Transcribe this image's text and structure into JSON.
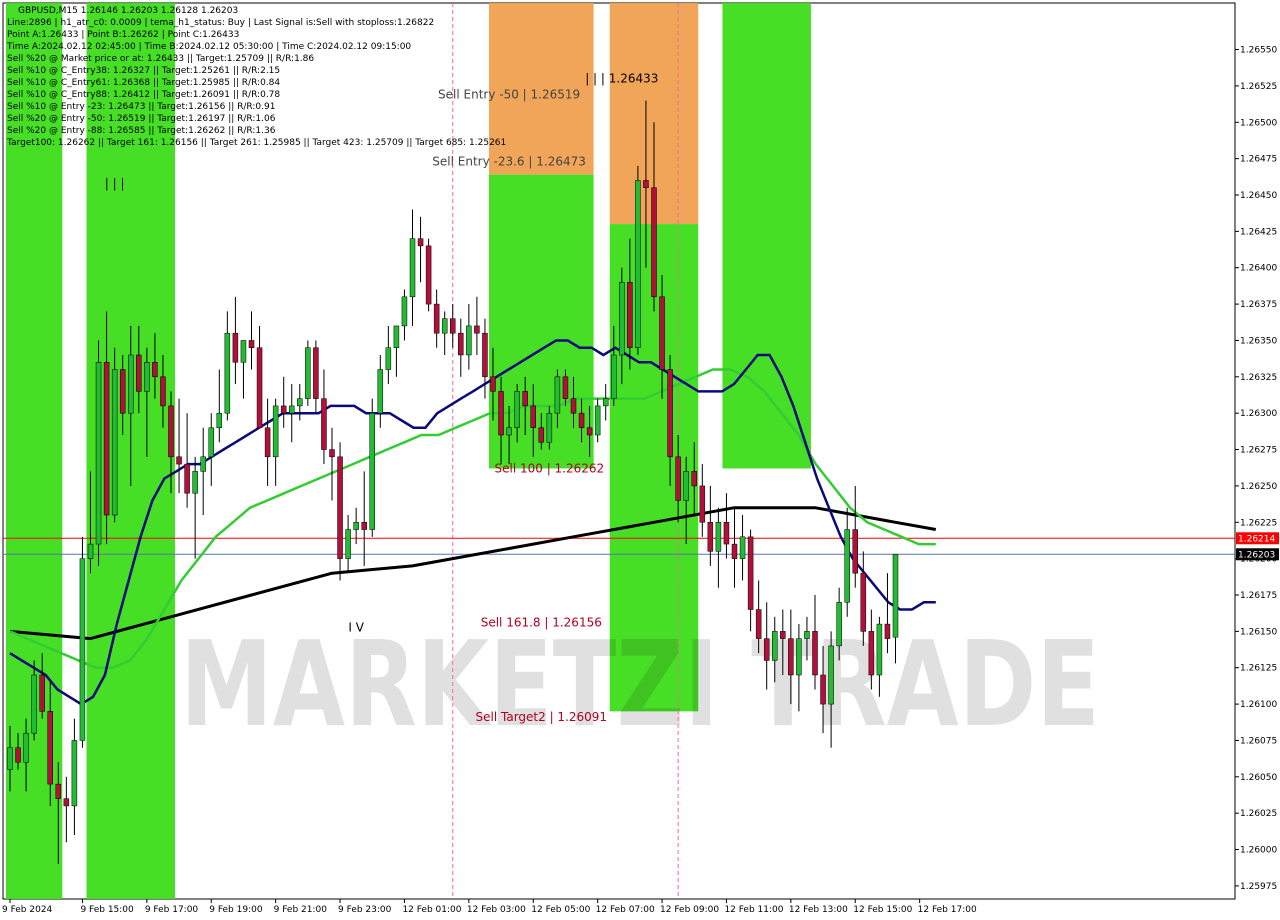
{
  "symbol_info": "GBPUSD,M15  1.26146 1.26203 1.26128 1.26203",
  "info_lines": [
    "Line:2896  |  h1_atr_c0: 0.0009  |  tema_h1_status: Buy  |  Last Signal is:Sell with stoploss:1.26822",
    "Point A:1.26433  |  Point B:1.26262  |  Point C:1.26433",
    "Time A:2024.02.12 02:45:00  |  Time B:2024.02.12 05:30:00  |  Time C:2024.02.12 09:15:00",
    "Sell %20 @ Market price or at: 1.26433  ||  Target:1.25709  ||  R/R:1.86",
    "Sell %10 @ C_Entry38: 1.26327  ||  Target:1.25261  ||  R/R:2.15",
    "Sell %10 @ C_Entry61: 1.26368  ||  Target:1.25985  ||  R/R:0.84",
    "Sell %10 @ C_Entry88: 1.26412  ||  Target:1.26091  ||  R/R:0.78",
    "Sell %10 @ Entry -23: 1.26473  ||  Target:1.26156  ||  R/R:0.91",
    "Sell %20 @ Entry -50: 1.26519  ||  Target:1.26197  ||  R/R:1.06",
    "Sell %20 @ Entry -88: 1.26585  ||  Target:1.26262  ||  R/R:1.36",
    "Target100: 1.26262  ||  Target 161: 1.26156  ||  Target 261: 1.25985  ||  Target 423: 1.25709  ||  Target 685: 1.25261"
  ],
  "watermark": "MARKETZI TRADE",
  "colors": {
    "bull": "#22bb33",
    "bear": "#b0103a",
    "wick": "#000000",
    "ma_fast": "#0a0a7a",
    "ma_mid": "#33cc33",
    "ma_slow": "#000000",
    "zone_green": "#3ddc1a",
    "zone_orange": "#f0a050",
    "red_line": "#ff0000",
    "blue_line": "#5577aa",
    "vline": "#ff6699",
    "sell_arrow": "#ff0000",
    "buy_arrow": "#0a0a9a"
  },
  "chart_data": {
    "type": "candlestick",
    "title": "GBPUSD,M15",
    "y_ticks": [
      "1.25975",
      "1.26000",
      "1.26025",
      "1.26050",
      "1.26075",
      "1.26100",
      "1.26125",
      "1.26150",
      "1.26175",
      "1.26200",
      "1.26225",
      "1.26250",
      "1.26275",
      "1.26300",
      "1.26325",
      "1.26350",
      "1.26375",
      "1.26400",
      "1.26425",
      "1.26450",
      "1.26475",
      "1.26500",
      "1.26525",
      "1.26550"
    ],
    "ylim": [
      1.25966,
      1.26582
    ],
    "x_ticks": [
      {
        "label": "9 Feb 2024",
        "bar": 0
      },
      {
        "label": "9 Feb 15:00",
        "bar": 9
      },
      {
        "label": "9 Feb 17:00",
        "bar": 17
      },
      {
        "label": "9 Feb 19:00",
        "bar": 25
      },
      {
        "label": "9 Feb 21:00",
        "bar": 33
      },
      {
        "label": "9 Feb 23:00",
        "bar": 41
      },
      {
        "label": "12 Feb 01:00",
        "bar": 49
      },
      {
        "label": "12 Feb 03:00",
        "bar": 57
      },
      {
        "label": "12 Feb 05:00",
        "bar": 65
      },
      {
        "label": "12 Feb 07:00",
        "bar": 73
      },
      {
        "label": "12 Feb 09:00",
        "bar": 81
      },
      {
        "label": "12 Feb 11:00",
        "bar": 89
      },
      {
        "label": "12 Feb 13:00",
        "bar": 97
      },
      {
        "label": "12 Feb 15:00",
        "bar": 105
      },
      {
        "label": "12 Feb 17:00",
        "bar": 113
      }
    ],
    "candles": [
      [
        1.26055,
        1.26085,
        1.2604,
        1.2607
      ],
      [
        1.2607,
        1.2608,
        1.26055,
        1.2606
      ],
      [
        1.2606,
        1.2609,
        1.2604,
        1.2608
      ],
      [
        1.2608,
        1.2613,
        1.26075,
        1.2612
      ],
      [
        1.2612,
        1.26135,
        1.2609,
        1.26095
      ],
      [
        1.26095,
        1.26115,
        1.2603,
        1.26045
      ],
      [
        1.26045,
        1.2606,
        1.2599,
        1.26035
      ],
      [
        1.26035,
        1.2605,
        1.26005,
        1.2603
      ],
      [
        1.2603,
        1.2609,
        1.2601,
        1.26075
      ],
      [
        1.26075,
        1.26215,
        1.2607,
        1.262
      ],
      [
        1.262,
        1.2626,
        1.2619,
        1.2621
      ],
      [
        1.2621,
        1.2635,
        1.26195,
        1.26335
      ],
      [
        1.26335,
        1.2637,
        1.2621,
        1.2623
      ],
      [
        1.2623,
        1.26345,
        1.26225,
        1.2633
      ],
      [
        1.2633,
        1.2634,
        1.26285,
        1.263
      ],
      [
        1.263,
        1.2636,
        1.2625,
        1.2634
      ],
      [
        1.2634,
        1.2636,
        1.263,
        1.26315
      ],
      [
        1.26315,
        1.26345,
        1.2627,
        1.26335
      ],
      [
        1.26335,
        1.26355,
        1.2631,
        1.26325
      ],
      [
        1.26325,
        1.2634,
        1.2629,
        1.26305
      ],
      [
        1.26305,
        1.26315,
        1.26245,
        1.2627
      ],
      [
        1.2627,
        1.2631,
        1.26245,
        1.26265
      ],
      [
        1.26265,
        1.263,
        1.26235,
        1.26245
      ],
      [
        1.26245,
        1.2627,
        1.262,
        1.2626
      ],
      [
        1.2626,
        1.2629,
        1.2623,
        1.2627
      ],
      [
        1.2627,
        1.263,
        1.2625,
        1.2629
      ],
      [
        1.2629,
        1.2633,
        1.2628,
        1.263
      ],
      [
        1.263,
        1.2637,
        1.26295,
        1.26355
      ],
      [
        1.26355,
        1.2638,
        1.2632,
        1.26335
      ],
      [
        1.26335,
        1.2635,
        1.2631,
        1.2635
      ],
      [
        1.2635,
        1.2637,
        1.2633,
        1.26345
      ],
      [
        1.26345,
        1.2636,
        1.263,
        1.2629
      ],
      [
        1.2629,
        1.2631,
        1.2625,
        1.2627
      ],
      [
        1.2627,
        1.2631,
        1.2625,
        1.26305
      ],
      [
        1.26305,
        1.26325,
        1.2629,
        1.263
      ],
      [
        1.263,
        1.2632,
        1.2628,
        1.26305
      ],
      [
        1.26305,
        1.2632,
        1.26295,
        1.2631
      ],
      [
        1.2631,
        1.2635,
        1.26305,
        1.26345
      ],
      [
        1.26345,
        1.2635,
        1.263,
        1.2631
      ],
      [
        1.2631,
        1.2633,
        1.26265,
        1.26275
      ],
      [
        1.26275,
        1.2629,
        1.2624,
        1.2627
      ],
      [
        1.2627,
        1.2628,
        1.26185,
        1.262
      ],
      [
        1.262,
        1.2623,
        1.2619,
        1.2622
      ],
      [
        1.2622,
        1.26235,
        1.2621,
        1.26225
      ],
      [
        1.26225,
        1.2626,
        1.26195,
        1.2622
      ],
      [
        1.2622,
        1.2631,
        1.26215,
        1.263
      ],
      [
        1.263,
        1.2634,
        1.2629,
        1.2633
      ],
      [
        1.2633,
        1.2636,
        1.2632,
        1.26345
      ],
      [
        1.26345,
        1.2636,
        1.26325,
        1.2636
      ],
      [
        1.2636,
        1.26385,
        1.2635,
        1.2638
      ],
      [
        1.2638,
        1.2644,
        1.2636,
        1.2642
      ],
      [
        1.2642,
        1.26435,
        1.2639,
        1.26415
      ],
      [
        1.26415,
        1.2642,
        1.2637,
        1.26375
      ],
      [
        1.26375,
        1.26385,
        1.26345,
        1.26355
      ],
      [
        1.26355,
        1.2637,
        1.2634,
        1.26365
      ],
      [
        1.26365,
        1.26375,
        1.26345,
        1.26355
      ],
      [
        1.26355,
        1.26365,
        1.26325,
        1.2634
      ],
      [
        1.2634,
        1.26375,
        1.2633,
        1.2636
      ],
      [
        1.2636,
        1.2638,
        1.2634,
        1.26355
      ],
      [
        1.26355,
        1.26365,
        1.2631,
        1.26325
      ],
      [
        1.26325,
        1.26345,
        1.26295,
        1.26315
      ],
      [
        1.26315,
        1.26325,
        1.26265,
        1.26285
      ],
      [
        1.26285,
        1.26305,
        1.26265,
        1.2629
      ],
      [
        1.2629,
        1.2632,
        1.2628,
        1.26315
      ],
      [
        1.26315,
        1.26325,
        1.26285,
        1.26305
      ],
      [
        1.26305,
        1.2632,
        1.2627,
        1.2629
      ],
      [
        1.2629,
        1.263,
        1.26275,
        1.2628
      ],
      [
        1.2628,
        1.26305,
        1.26275,
        1.263
      ],
      [
        1.263,
        1.2633,
        1.2629,
        1.26325
      ],
      [
        1.26325,
        1.2633,
        1.26305,
        1.2631
      ],
      [
        1.2631,
        1.26325,
        1.2629,
        1.263
      ],
      [
        1.263,
        1.2631,
        1.2628,
        1.2629
      ],
      [
        1.2629,
        1.26305,
        1.2627,
        1.26285
      ],
      [
        1.26285,
        1.2631,
        1.2628,
        1.26305
      ],
      [
        1.26305,
        1.2632,
        1.26295,
        1.2631
      ],
      [
        1.2631,
        1.2636,
        1.26305,
        1.2634
      ],
      [
        1.2634,
        1.264,
        1.2632,
        1.2639
      ],
      [
        1.2639,
        1.2642,
        1.2633,
        1.26345
      ],
      [
        1.26345,
        1.2647,
        1.2634,
        1.2646
      ],
      [
        1.2646,
        1.26515,
        1.264,
        1.26455
      ],
      [
        1.26455,
        1.265,
        1.2637,
        1.2638
      ],
      [
        1.2638,
        1.26395,
        1.2631,
        1.2633
      ],
      [
        1.2633,
        1.2634,
        1.2625,
        1.2627
      ],
      [
        1.2627,
        1.26285,
        1.26225,
        1.2624
      ],
      [
        1.2624,
        1.2627,
        1.2621,
        1.2626
      ],
      [
        1.2626,
        1.2628,
        1.2623,
        1.2625
      ],
      [
        1.2625,
        1.26265,
        1.26215,
        1.26225
      ],
      [
        1.26225,
        1.2625,
        1.26195,
        1.26205
      ],
      [
        1.26205,
        1.26235,
        1.2618,
        1.26225
      ],
      [
        1.26225,
        1.26245,
        1.262,
        1.2621
      ],
      [
        1.2621,
        1.26235,
        1.2618,
        1.262
      ],
      [
        1.262,
        1.2623,
        1.26185,
        1.26215
      ],
      [
        1.26215,
        1.2622,
        1.2615,
        1.26165
      ],
      [
        1.26165,
        1.26185,
        1.26135,
        1.26145
      ],
      [
        1.26145,
        1.2617,
        1.2611,
        1.2613
      ],
      [
        1.2613,
        1.2616,
        1.26115,
        1.2615
      ],
      [
        1.2615,
        1.26165,
        1.2612,
        1.26145
      ],
      [
        1.26145,
        1.26165,
        1.261,
        1.2612
      ],
      [
        1.2612,
        1.26155,
        1.26095,
        1.26145
      ],
      [
        1.26145,
        1.2616,
        1.2613,
        1.2615
      ],
      [
        1.2615,
        1.26175,
        1.2611,
        1.2612
      ],
      [
        1.2612,
        1.2614,
        1.2608,
        1.261
      ],
      [
        1.261,
        1.2615,
        1.2607,
        1.2614
      ],
      [
        1.2614,
        1.2618,
        1.2613,
        1.2617
      ],
      [
        1.2617,
        1.26235,
        1.2616,
        1.2622
      ],
      [
        1.2622,
        1.2625,
        1.2618,
        1.2619
      ],
      [
        1.2619,
        1.26205,
        1.2614,
        1.2615
      ],
      [
        1.2615,
        1.26165,
        1.2611,
        1.2612
      ],
      [
        1.2612,
        1.2616,
        1.26105,
        1.26155
      ],
      [
        1.26155,
        1.2619,
        1.26135,
        1.26145
      ],
      [
        1.26146,
        1.26203,
        1.26128,
        1.26203
      ]
    ],
    "ma_fast": [
      1.26135,
      1.2613,
      1.26125,
      1.2612,
      1.2611,
      1.26105,
      1.261,
      1.26105,
      1.2612,
      1.26155,
      1.26185,
      1.26215,
      1.2624,
      1.26255,
      1.2626,
      1.26265,
      1.26265,
      1.2627,
      1.26275,
      1.2628,
      1.26285,
      1.2629,
      1.26295,
      1.263,
      1.263,
      1.263,
      1.263,
      1.26305,
      1.26305,
      1.26305,
      1.263,
      1.263,
      1.263,
      1.26295,
      1.2629,
      1.2629,
      1.263,
      1.26305,
      1.2631,
      1.26315,
      1.2632,
      1.26325,
      1.2633,
      1.26335,
      1.2634,
      1.26345,
      1.2635,
      1.2635,
      1.26345,
      1.26345,
      1.2634,
      1.26345,
      1.2634,
      1.26335,
      1.26335,
      1.2633,
      1.26325,
      1.2632,
      1.26315,
      1.26315,
      1.26315,
      1.2632,
      1.2633,
      1.2634,
      1.2634,
      1.26325,
      1.26305,
      1.2628,
      1.26255,
      1.26235,
      1.26215,
      1.262,
      1.2619,
      1.2618,
      1.2617,
      1.26165,
      1.26165,
      1.2617,
      1.2617
    ],
    "ma_fast_start_bar": 0,
    "ma_mid": [
      1.2615,
      1.26145,
      1.2614,
      1.26135,
      1.2613,
      1.26125,
      1.26125,
      1.2613,
      1.26145,
      1.26165,
      1.26185,
      1.262,
      1.26215,
      1.26225,
      1.26235,
      1.2624,
      1.26245,
      1.2625,
      1.26255,
      1.2626,
      1.26265,
      1.2627,
      1.26275,
      1.2628,
      1.26285,
      1.26285,
      1.2629,
      1.26295,
      1.263,
      1.263,
      1.26305,
      1.26305,
      1.26305,
      1.2631,
      1.2631,
      1.2631,
      1.2631,
      1.2631,
      1.26315,
      1.2632,
      1.26325,
      1.2633,
      1.2633,
      1.26325,
      1.26315,
      1.263,
      1.26285,
      1.26265,
      1.2625,
      1.26235,
      1.26225,
      1.2622,
      1.26215,
      1.2621,
      1.2621
    ],
    "ma_mid_start_bar": 0,
    "ma_slow_points": [
      [
        0,
        1.2615
      ],
      [
        10,
        1.26145
      ],
      [
        20,
        1.2616
      ],
      [
        30,
        1.26175
      ],
      [
        40,
        1.2619
      ],
      [
        50,
        1.26195
      ],
      [
        60,
        1.26205
      ],
      [
        70,
        1.26215
      ],
      [
        80,
        1.26225
      ],
      [
        90,
        1.26235
      ],
      [
        100,
        1.26235
      ],
      [
        110,
        1.26225
      ],
      [
        115,
        1.2622
      ]
    ],
    "zones": [
      {
        "type": "green",
        "x0": 0,
        "x1": 6,
        "top": 1.26582,
        "bottom": 1.25966
      },
      {
        "type": "green",
        "x0": 10,
        "x1": 20,
        "top": 1.26582,
        "bottom": 1.25966
      },
      {
        "type": "orange",
        "x0": 60,
        "x1": 72,
        "top": 1.26582,
        "bottom": 1.26464
      },
      {
        "type": "green",
        "x0": 60,
        "x1": 72,
        "top": 1.26464,
        "bottom": 1.26262
      },
      {
        "type": "orange",
        "x0": 75,
        "x1": 85,
        "top": 1.26582,
        "bottom": 1.2643
      },
      {
        "type": "green",
        "x0": 75,
        "x1": 85,
        "top": 1.2643,
        "bottom": 1.26095
      },
      {
        "type": "green",
        "x0": 89,
        "x1": 99,
        "top": 1.26582,
        "bottom": 1.26262
      }
    ],
    "level_labels": [
      {
        "text": "Sell Entry -50 | 1.26519",
        "price": 1.26519,
        "bar": 62,
        "color": "#444444"
      },
      {
        "text": "Sell Entry -23.6 | 1.26473",
        "price": 1.26473,
        "bar": 62,
        "color": "#444444"
      },
      {
        "text": "Sell 100 | 1.26262",
        "price": 1.26262,
        "bar": 67,
        "color": "#b00020"
      },
      {
        "text": "Sell 161.8 | 1.26156",
        "price": 1.26156,
        "bar": 66,
        "color": "#b00020"
      },
      {
        "text": "Sell Target2 | 1.26091",
        "price": 1.26091,
        "bar": 66,
        "color": "#b00020"
      },
      {
        "text": "| | | 1.26433",
        "price": 1.2653,
        "bar": 76,
        "color": "#000000"
      }
    ],
    "wave_labels": [
      {
        "text": "| | |",
        "price": 1.26455,
        "bar": 13
      },
      {
        "text": "I V",
        "price": 1.2615,
        "bar": 43
      }
    ],
    "red_line": 1.26214,
    "red_line_label": "1.26214",
    "blue_line": 1.26203,
    "blue_line_label": "1.26203",
    "vlines": [
      55,
      83
    ]
  }
}
